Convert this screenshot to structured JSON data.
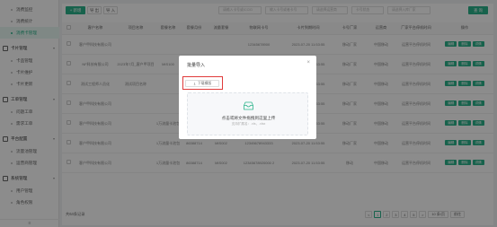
{
  "sidebar": {
    "items": [
      {
        "label": "消费监控",
        "type": "item",
        "active": false
      },
      {
        "label": "消费统计",
        "type": "item",
        "active": false
      },
      {
        "label": "消费卡管理",
        "type": "item",
        "active": true
      },
      {
        "label": "卡片管理",
        "type": "group"
      },
      {
        "label": "卡品管理",
        "type": "item",
        "active": false
      },
      {
        "label": "卡片维护",
        "type": "item",
        "active": false
      },
      {
        "label": "卡片更新",
        "type": "item",
        "active": false
      },
      {
        "label": "工单管理",
        "type": "group"
      },
      {
        "label": "问题工单",
        "type": "item",
        "active": false
      },
      {
        "label": "需求工单",
        "type": "item",
        "active": false
      },
      {
        "label": "平台配置",
        "type": "group"
      },
      {
        "label": "流量池管理",
        "type": "item",
        "active": false
      },
      {
        "label": "运营商管理",
        "type": "item",
        "active": false
      },
      {
        "label": "系统管理",
        "type": "group"
      },
      {
        "label": "用户管理",
        "type": "item",
        "active": false
      },
      {
        "label": "角色权限",
        "type": "item",
        "active": false
      }
    ],
    "collapse_icon": "≡"
  },
  "toolbar": {
    "add_label": "+ 新增",
    "import_label": "导 出",
    "export_label": "导 入",
    "filters": [
      "请输入卡号或ICCID",
      "输入卡号或者卡号",
      "请选择运营商",
      "卡号状态",
      "请选择入库厂家"
    ],
    "search_label": "查 询"
  },
  "table": {
    "headers": [
      "",
      "客户名称",
      "项目名称",
      "套餐名称",
      "套餐月份",
      "流量套餐",
      "物联网卡号",
      "卡片到期时间",
      "卡号厂家",
      "运营商",
      "厂家平台停机时间",
      "操作"
    ],
    "rows": [
      [
        "",
        "客户甲科技有限公司",
        "",
        "",
        "",
        "",
        "12345678900",
        "2023-07-20 11:53:55",
        "移动厂家",
        "中国移动",
        "运营平台停机时间",
        ""
      ],
      [
        "",
        "NF科技有限公司",
        "2023年7月_客户甲项目",
        "MIS100",
        "",
        "",
        "",
        "2023-07-20 11:53:55",
        "移动厂家",
        "中国移动",
        "运营平台停机时间",
        ""
      ],
      [
        "",
        "测试工程师人员化",
        "测试项目名称",
        "",
        "公共流量池套餐",
        "",
        "",
        "2023-07-20 11:53:55",
        "移动厂家",
        "中国移动",
        "运营平台停机时间",
        ""
      ],
      [
        "",
        "客户甲科技有限公司",
        "",
        "",
        "",
        "",
        "",
        "2023-07-20 11:53:55",
        "移动厂家",
        "中国移动",
        "运营平台停机时间",
        ""
      ],
      [
        "",
        "客户甲科技有限公司",
        "",
        "1万流量卡池包",
        "86388714",
        "MIS002",
        "12345678913356 7896321",
        "2023-07-20 11:53:55",
        "移动厂家",
        "中国移动",
        "运营平台停机时间",
        ""
      ],
      [
        "",
        "客户甲科技有限公司",
        "",
        "1万流量卡池包",
        "86388714",
        "MIS002",
        "12345678943333",
        "2023-07-20 11:53:55",
        "移动厂家",
        "中国移动",
        "运营平台停机时间",
        ""
      ],
      [
        "",
        "客户甲科技有限公司",
        "",
        "1万流量卡池包",
        "86388714",
        "MIS002",
        "12345678920000 2",
        "2023-07-20 11:53:55",
        "移动",
        "中国移动",
        "运营平台停机时间",
        ""
      ]
    ],
    "ops": [
      "编辑",
      "删除",
      "详情"
    ]
  },
  "footer": {
    "total": "共64条记录",
    "pages": [
      "<",
      "1",
      "2",
      "3",
      "4",
      "5",
      ">"
    ],
    "current_page": "1",
    "page_size": "10 条/页",
    "jump": "前往"
  },
  "modal": {
    "title": "批量导入",
    "close_icon": "×",
    "download_label": "下载模版",
    "download_icon": "⇩",
    "drop_text": "点击或将文件拖拽到这里上传",
    "drop_hint": "支持扩展名：.xls，.xlsx",
    "accent_color": "#2bb38a",
    "highlight_color": "#e03a3a"
  }
}
